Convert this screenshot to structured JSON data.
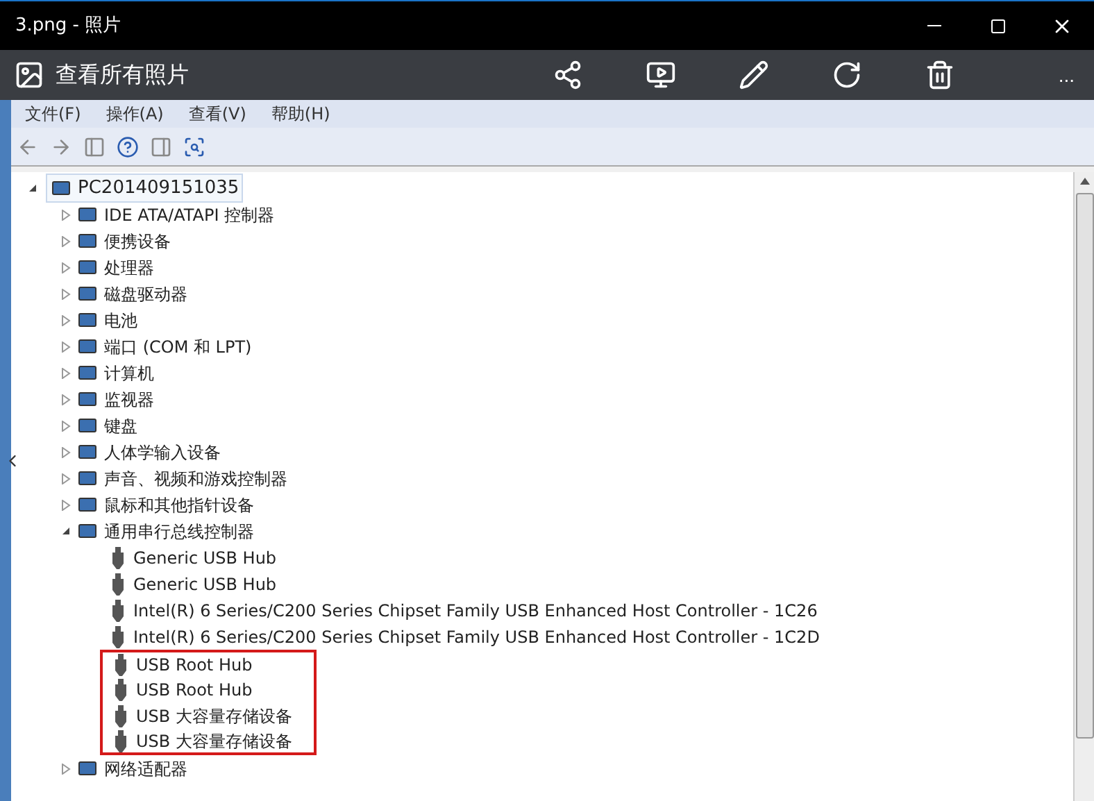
{
  "window": {
    "title": "3.png - 照片"
  },
  "photo_toolbar": {
    "back_label": "查看所有照片",
    "more": "..."
  },
  "menu": [
    "文件(F)",
    "操作(A)",
    "查看(V)",
    "帮助(H)"
  ],
  "tree": {
    "label": "PC201409151035",
    "expanded": true,
    "children": [
      {
        "label": "IDE ATA/ATAPI 控制器",
        "expanded": false
      },
      {
        "label": "便携设备",
        "expanded": false
      },
      {
        "label": "处理器",
        "expanded": false
      },
      {
        "label": "磁盘驱动器",
        "expanded": false
      },
      {
        "label": "电池",
        "expanded": false
      },
      {
        "label": "端口 (COM 和 LPT)",
        "expanded": false
      },
      {
        "label": "计算机",
        "expanded": false
      },
      {
        "label": "监视器",
        "expanded": false
      },
      {
        "label": "键盘",
        "expanded": false
      },
      {
        "label": "人体学输入设备",
        "expanded": false
      },
      {
        "label": "声音、视频和游戏控制器",
        "expanded": false
      },
      {
        "label": "鼠标和其他指针设备",
        "expanded": false
      },
      {
        "label": "通用串行总线控制器",
        "expanded": true,
        "children": [
          {
            "label": "Generic USB Hub",
            "marked": false
          },
          {
            "label": "Generic USB Hub",
            "marked": false
          },
          {
            "label": "Intel(R) 6 Series/C200 Series Chipset Family USB Enhanced Host Controller - 1C26",
            "marked": false
          },
          {
            "label": "Intel(R) 6 Series/C200 Series Chipset Family USB Enhanced Host Controller - 1C2D",
            "marked": false
          },
          {
            "label": "USB Root Hub",
            "marked": true
          },
          {
            "label": "USB Root Hub",
            "marked": true
          },
          {
            "label": "USB 大容量存储设备",
            "marked": true
          },
          {
            "label": "USB 大容量存储设备",
            "marked": true
          }
        ]
      },
      {
        "label": "网络适配器",
        "expanded": false
      }
    ]
  }
}
